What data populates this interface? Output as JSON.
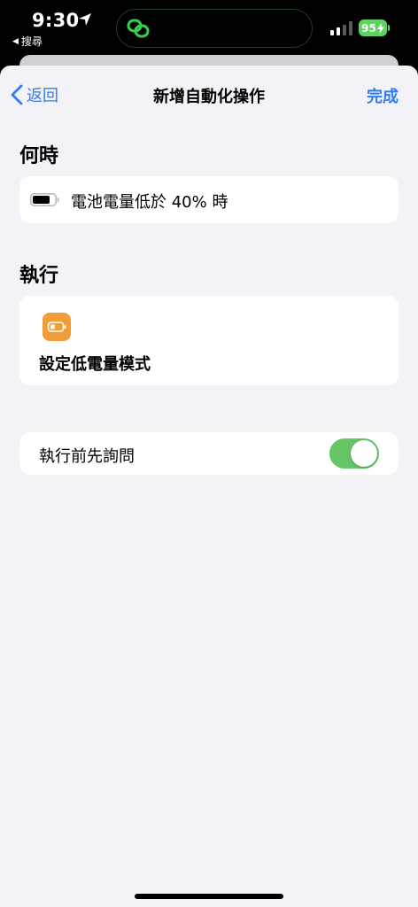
{
  "status_bar": {
    "time": "9:30",
    "back_app": "搜尋",
    "battery_level": "95",
    "battery_color": "#5fd35f"
  },
  "nav": {
    "back_label": "返回",
    "title": "新增自動化操作",
    "done_label": "完成",
    "accent_color": "#2f7cf6"
  },
  "when": {
    "heading": "何時",
    "trigger_text": "電池電量低於 40% 時",
    "icon": "battery-icon"
  },
  "do": {
    "heading": "執行",
    "action_label": "設定低電量模式",
    "icon": "low-power-battery-icon",
    "icon_color": "#f19d38"
  },
  "ask_before": {
    "label": "執行前先詢問",
    "enabled": true,
    "toggle_color": "#65c466"
  }
}
